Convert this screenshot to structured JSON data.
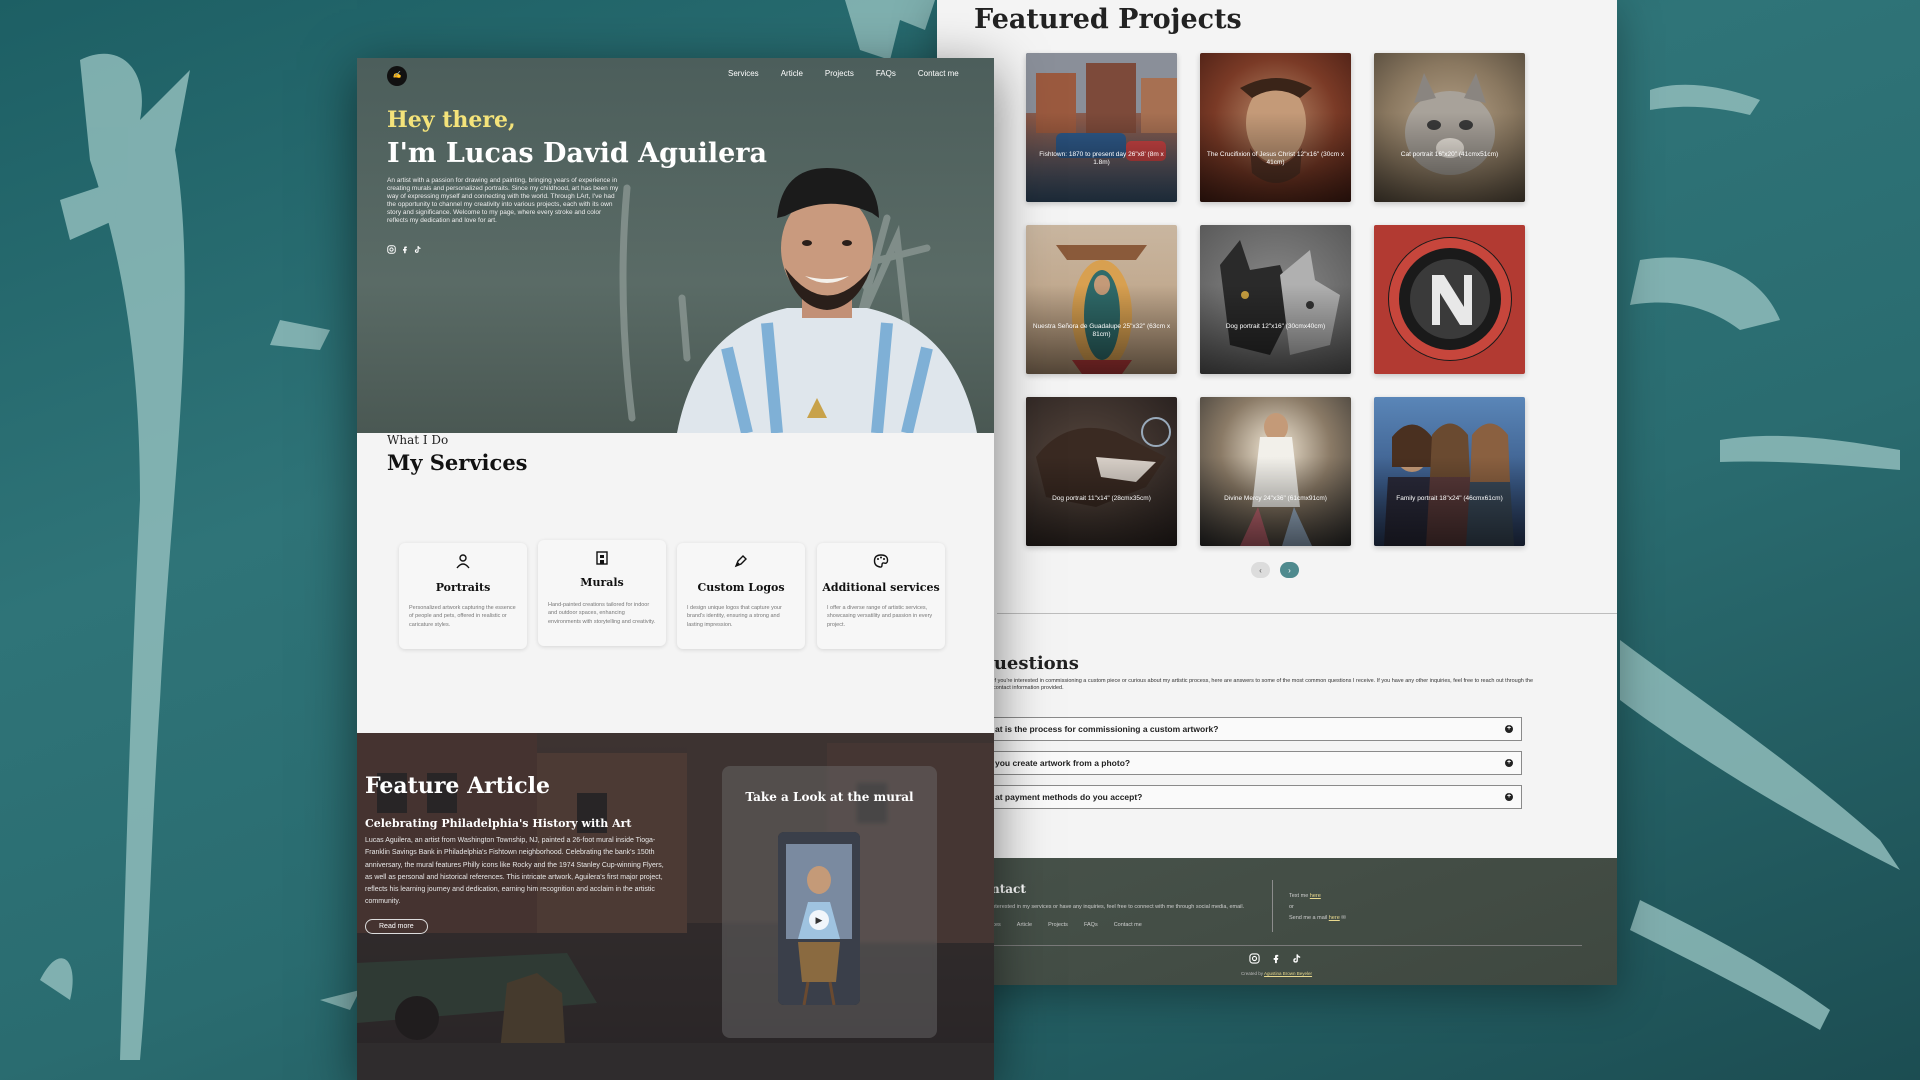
{
  "colors": {
    "accent_yellow": "#f4e37a",
    "teal_bg": "#2f7478",
    "pager_active": "#4f8a8e"
  },
  "hero": {
    "nav": [
      "Services",
      "Article",
      "Projects",
      "FAQs",
      "Contact me"
    ],
    "greeting": "Hey there,",
    "name": "I'm Lucas David Aguilera",
    "bio": "An artist with a passion for drawing and painting, bringing years of experience in creating murals and personalized portraits. Since my childhood, art has been my way of expressing myself and connecting with the world. Through LArt, I've had the opportunity to channel my creativity into various projects, each with its own story and significance. Welcome to my page, where every stroke and color reflects my dedication and love for art.",
    "social_icons": [
      "instagram-icon",
      "facebook-icon",
      "tiktok-icon"
    ]
  },
  "services": {
    "eyebrow": "What I Do",
    "title": "My Services",
    "items": [
      {
        "icon": "person-icon",
        "title": "Portraits",
        "desc": "Personalized artwork capturing the essence of people and pets, offered in realistic or caricature styles."
      },
      {
        "icon": "building-icon",
        "title": "Murals",
        "desc": "Hand-painted creations tailored for indoor and outdoor spaces, enhancing environments with storytelling and creativity."
      },
      {
        "icon": "pen-icon",
        "title": "Custom Logos",
        "desc": "I design unique logos that capture your brand's identity, ensuring a strong and lasting impression."
      },
      {
        "icon": "palette-icon",
        "title": "Additional services",
        "desc": "I offer a diverse range of artistic services, showcasing versatility and passion in every project."
      }
    ]
  },
  "feature": {
    "title": "Feature Article",
    "subtitle": "Celebrating Philadelphia's History with Art",
    "body": "Lucas Aguilera, an artist from Washington Township, NJ, painted a 26-foot mural inside Tioga-Franklin Savings Bank in Philadelphia's Fishtown neighborhood. Celebrating the bank's 150th anniversary, the mural features Philly icons like Rocky and the 1974 Stanley Cup-winning Flyers, as well as personal and historical references. This intricate artwork, Aguilera's first major project, reflects his learning journey and dedication, earning him recognition and acclaim in the artistic community.",
    "button": "Read more",
    "mural_title": "Take a Look at the mural"
  },
  "projects": {
    "title": "Featured Projects",
    "items": [
      {
        "caption": "Fishtown: 1870 to present day 26\"x8' (8m x 1.8m)"
      },
      {
        "caption": "The Crucifixion of Jesus Christ 12\"x16\" (30cm x 41cm)"
      },
      {
        "caption": "Cat portrait 16\"x20\" (41cmx51cm)"
      },
      {
        "caption": "Nuestra Señora de Guadalupe 25\"x32\" (63cm x 81cm)"
      },
      {
        "caption": "Dog portrait 12\"x16\" (30cmx40cm)"
      },
      {
        "caption": ""
      },
      {
        "caption": "Dog portrait 11\"x14\" (28cmx35cm)"
      },
      {
        "caption": "Divine Mercy 24\"x36\" (61cmx91cm)"
      },
      {
        "caption": "Family portrait 18\"x24\" (46cmx61cm)"
      }
    ],
    "prev": "‹",
    "next": "›"
  },
  "faq": {
    "title": "equent questions",
    "intro": "If you're interested in commissioning a custom piece or curious about my artistic process, here are answers to some of the most common questions I receive. If you have any other inquiries, feel free to reach out through the contact information provided.",
    "items": [
      "at is the process for commissioning a custom artwork?",
      "you create artwork from a photo?",
      "at payment methods do you accept?"
    ]
  },
  "footer": {
    "title": "ntact",
    "text": "interested in my services or have any inquiries, feel free to connect with me through social media, email.",
    "links": [
      "ices",
      "Article",
      "Projects",
      "FAQs",
      "Contact me"
    ],
    "text_me": "Text me",
    "here": "here",
    "or": "or",
    "mail": "Send me a mail",
    "credit_prefix": "Created by",
    "credit_name": "Agustina Brown Beyeler"
  }
}
